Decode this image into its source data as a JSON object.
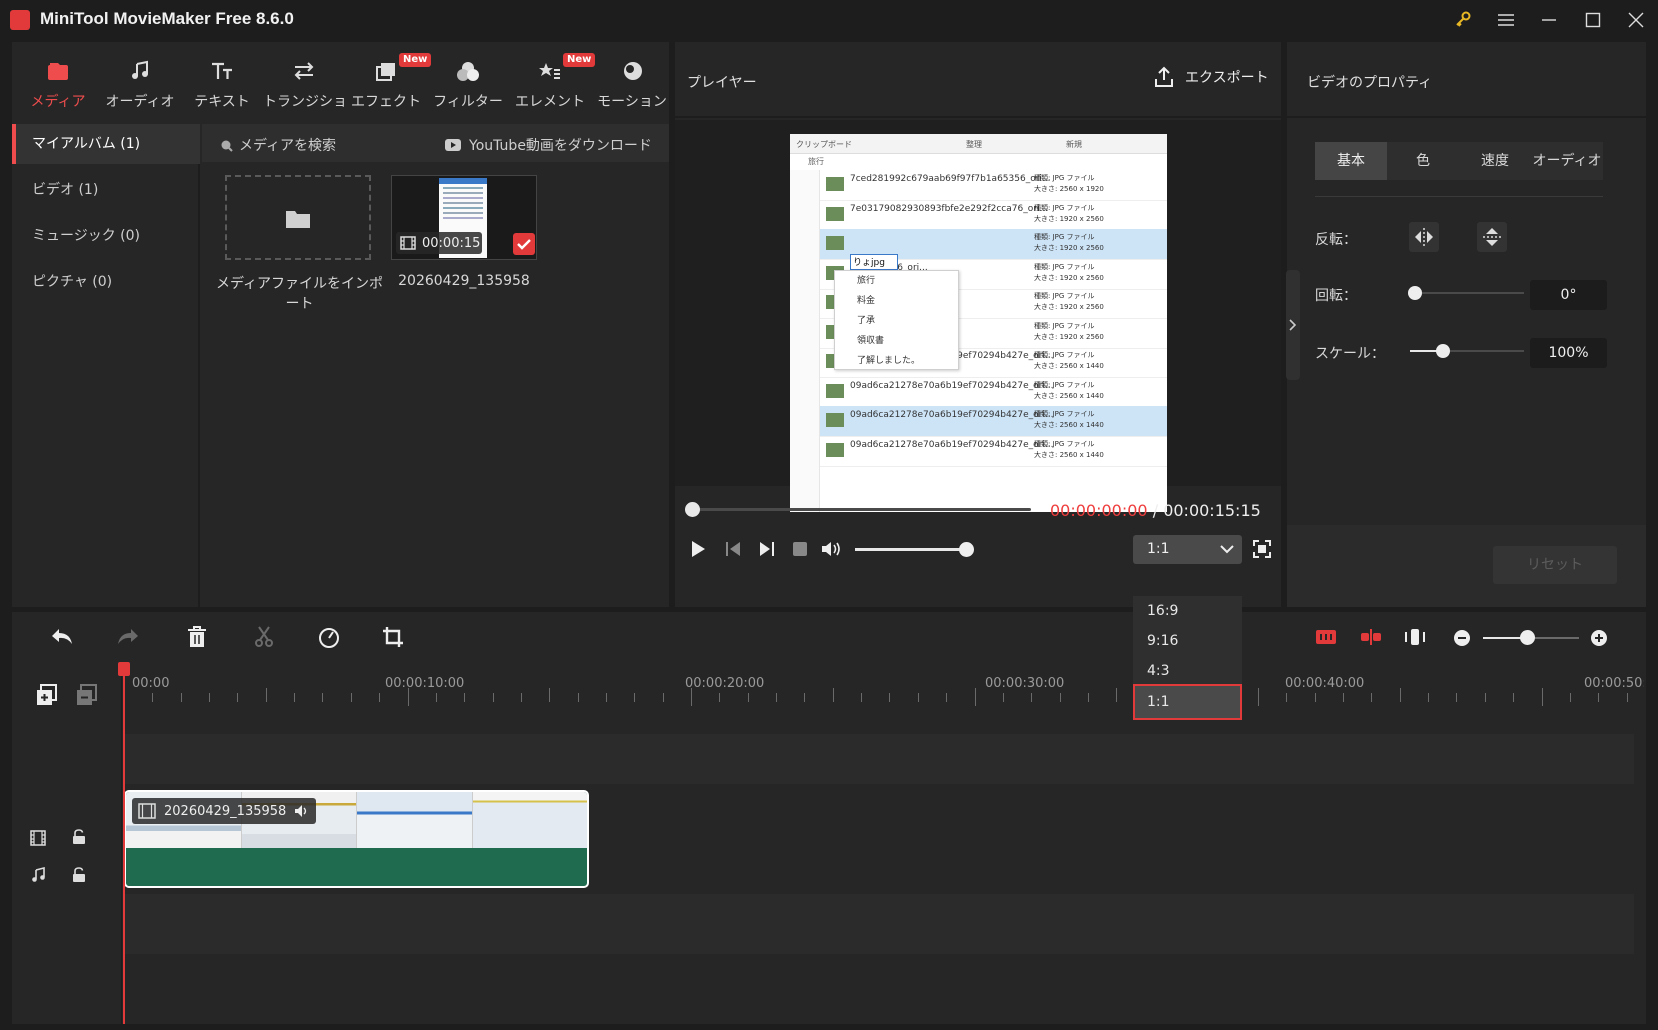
{
  "app": {
    "title": "MiniTool MovieMaker Free 8.6.0"
  },
  "toolbar": {
    "items": [
      {
        "label": "メディア",
        "icon": "media-icon",
        "new": false
      },
      {
        "label": "オーディオ",
        "icon": "audio-icon",
        "new": false
      },
      {
        "label": "テキスト",
        "icon": "text-icon",
        "new": false
      },
      {
        "label": "トランジション",
        "icon": "transition-icon",
        "new": false
      },
      {
        "label": "エフェクト",
        "icon": "effect-icon",
        "new": true
      },
      {
        "label": "フィルター",
        "icon": "filter-icon",
        "new": false
      },
      {
        "label": "エレメント",
        "icon": "element-icon",
        "new": true
      },
      {
        "label": "モーション",
        "icon": "motion-icon",
        "new": false
      }
    ],
    "new_badge": "New"
  },
  "albums": [
    {
      "label": "マイアルバム (1)"
    },
    {
      "label": "ビデオ (1)"
    },
    {
      "label": "ミュージック (0)"
    },
    {
      "label": "ピクチャ (0)"
    }
  ],
  "media": {
    "search_label": "メディアを検索",
    "youtube_label": "YouTube動画をダウンロード",
    "import_label": "メディアファイルをインポート",
    "clip_name": "20260429_135958",
    "clip_duration": "00:00:15"
  },
  "player": {
    "title": "プレイヤー",
    "export_label": "エクスポート",
    "current_time": "00:00:00:00",
    "separator": "/",
    "total_time": "00:00:15:15",
    "ratio_selected": "1:1",
    "ratio_options": [
      "16:9",
      "9:16",
      "4:3",
      "1:1"
    ],
    "frame": {
      "header_a": "クリップボード",
      "header_b": "整理",
      "header_c": "新規",
      "breadcrumb": "旅行",
      "rename_value": "りょjpg",
      "context_items": [
        "旅行",
        "料金",
        "了承",
        "領収書",
        "了解しました。"
      ],
      "rows": [
        {
          "name": "7ced281992c679aab69f97f7b1a65356_ori...",
          "type": "種類: JPG ファイル",
          "size": "大きさ: 2560 x 1920",
          "sel": false
        },
        {
          "name": "7e03179082930893fbfe2e292f2cca76_ori...",
          "type": "種類: JPG ファイル",
          "size": "大きさ: 1920 x 2560",
          "sel": false
        },
        {
          "name": "",
          "type": "種類: JPG ファイル",
          "size": "大きさ: 1920 x 2560",
          "sel": true
        },
        {
          "name": "292f2cca76_ori...",
          "type": "種類: JPG ファイル",
          "size": "大きさ: 1920 x 2560",
          "sel": false
        },
        {
          "name": "292f2cca76_ori...",
          "type": "種類: JPG ファイル",
          "size": "大きさ: 1920 x 2560",
          "sel": false
        },
        {
          "name": "292f2cca76_ori...",
          "type": "種類: JPG ファイル",
          "size": "大きさ: 1920 x 2560",
          "sel": false
        },
        {
          "name": "09ad6ca21278e70a6b19ef70294b427e_ori...",
          "type": "種類: JPG ファイル",
          "size": "大きさ: 2560 x 1440",
          "sel": false
        },
        {
          "name": "09ad6ca21278e70a6b19ef70294b427e_ori...",
          "type": "種類: JPG ファイル",
          "size": "大きさ: 2560 x 1440",
          "sel": false
        },
        {
          "name": "09ad6ca21278e70a6b19ef70294b427e_ori...",
          "type": "種類: JPG ファイル",
          "size": "大きさ: 2560 x 1440",
          "sel": true
        },
        {
          "name": "09ad6ca21278e70a6b19ef70294b427e_ori...",
          "type": "種類: JPG ファイル",
          "size": "大きさ: 2560 x 1440",
          "sel": false
        }
      ]
    }
  },
  "properties": {
    "title": "ビデオのプロパティ",
    "tabs": [
      "基本",
      "色",
      "速度",
      "オーディオ"
    ],
    "flip_label": "反転：",
    "rotate_label": "回転：",
    "rotate_value": "0°",
    "scale_label": "スケール：",
    "scale_value": "100%",
    "reset_label": "リセット"
  },
  "timeline": {
    "ticks": [
      "00:00",
      "00:00:10:00",
      "00:00:20:00",
      "00:00:30:00",
      "00:00:40:00",
      "00:00:50:00"
    ],
    "clip_name": "20260429_135958"
  },
  "colors": {
    "accent": "#e23a3a",
    "clip_green": "#1e6b4f"
  }
}
